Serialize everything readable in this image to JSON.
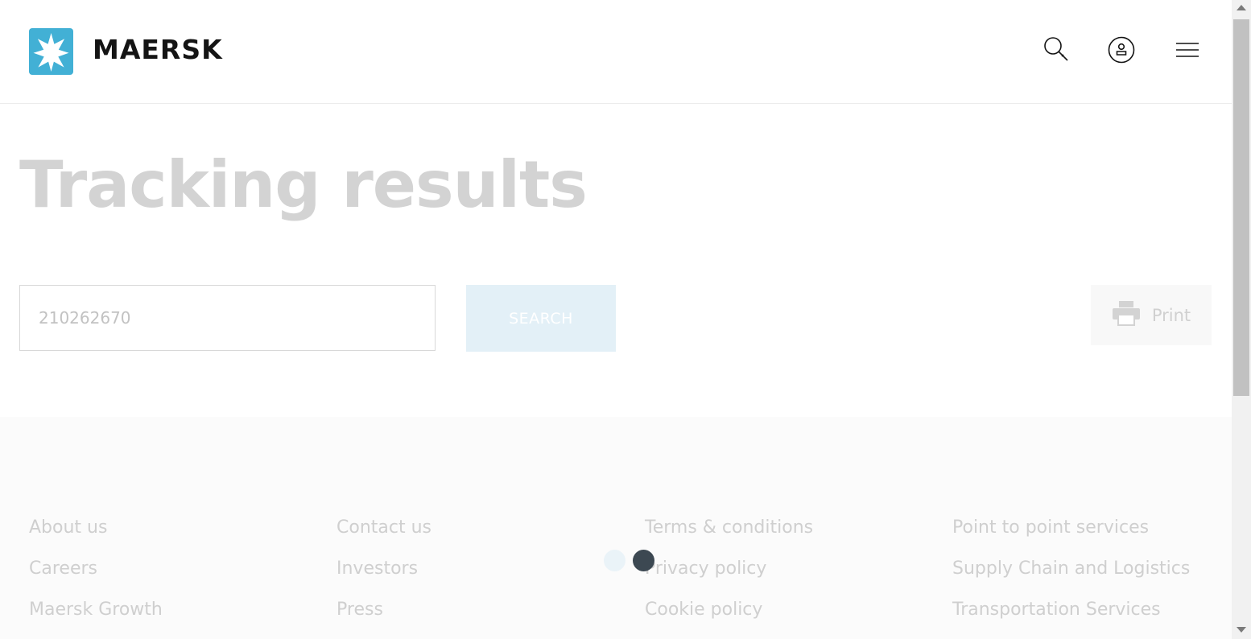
{
  "header": {
    "brand": "MAERSK",
    "icons": {
      "search": "search-icon",
      "account": "user-account-icon",
      "menu": "hamburger-menu-icon"
    }
  },
  "main": {
    "title": "Tracking results",
    "search": {
      "value": "210262670",
      "button_label": "SEARCH"
    },
    "print_label": "Print"
  },
  "footer": {
    "columns": [
      [
        "About us",
        "Careers",
        "Maersk Growth"
      ],
      [
        "Contact us",
        "Investors",
        "Press"
      ],
      [
        "Terms & conditions",
        "Privacy policy",
        "Cookie policy"
      ],
      [
        "Point to point services",
        "Supply Chain and Logistics",
        "Transportation Services"
      ]
    ]
  },
  "colors": {
    "brand_blue": "#42b0d5",
    "title_text": "#d3d3d3",
    "search_button_bg": "#e3f0f7",
    "loader_dark": "#3c4852",
    "loader_light": "#eaf3f8"
  }
}
